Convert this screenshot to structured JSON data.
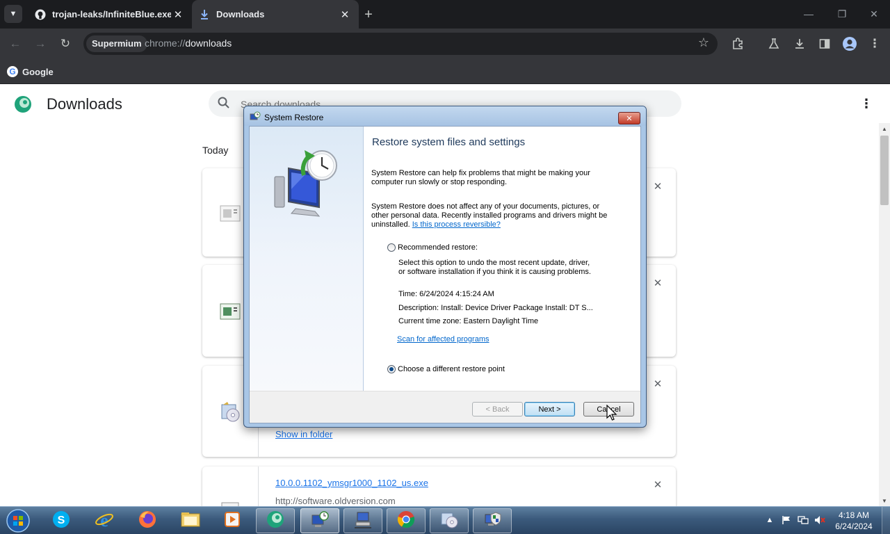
{
  "browser": {
    "tabs": [
      {
        "label": "trojan-leaks/InfiniteBlue.exe at",
        "active": false,
        "icon": "github-icon"
      },
      {
        "label": "Downloads",
        "active": true,
        "icon": "download-icon"
      }
    ],
    "omnibox": {
      "chip_label": "Supermium",
      "url_scheme": "chrome://",
      "url_host": "downloads"
    },
    "bookmarks": [
      {
        "label": "Google",
        "icon": "google-icon"
      }
    ]
  },
  "downloads_page": {
    "title": "Downloads",
    "search_placeholder": "Search downloads",
    "section_label": "Today",
    "items": [
      {
        "icon": "document-icon"
      },
      {
        "icon": "document-icon"
      },
      {
        "icon": "restore-disc-icon",
        "show_in_folder": "Show in folder"
      },
      {
        "name": "10.0.0.1102_ymsgr1000_1102_us.exe",
        "url": "http://software.oldversion.com",
        "icon": "exe-icon"
      }
    ]
  },
  "dialog": {
    "title": "System Restore",
    "heading": "Restore system files and settings",
    "paragraph1": [
      "System Restore can help fix problems that might be making your",
      "computer run slowly or stop responding."
    ],
    "paragraph2": [
      "System Restore does not affect any of your documents, pictures, or",
      "other personal data. Recently installed programs and drivers might be"
    ],
    "paragraph2_last": "uninstalled.",
    "reversible_link": "Is this process reversible?",
    "recommended_label": "Recommended restore:",
    "recommended_desc": [
      "Select this option to undo the most recent update, driver,",
      "or software installation if you think it is causing problems."
    ],
    "time": "Time: 6/24/2024 4:15:24 AM",
    "description": "Description: Install: Device Driver Package Install: DT S...",
    "timezone": "Current time zone: Eastern Daylight Time",
    "scan_link": "Scan for affected programs",
    "choose_label": "Choose a different restore point",
    "selected_option": "choose-different",
    "buttons": {
      "back": "< Back",
      "next": "Next >",
      "cancel": "Cancel"
    }
  },
  "taskbar": {
    "pinned": [
      {
        "icon": "skype-icon"
      },
      {
        "icon": "internet-explorer-icon"
      },
      {
        "icon": "firefox-icon"
      },
      {
        "icon": "file-explorer-icon"
      },
      {
        "icon": "media-player-icon"
      },
      {
        "icon": "supermium-icon"
      },
      {
        "icon": "system-restore-icon"
      },
      {
        "icon": "network-computer-icon"
      },
      {
        "icon": "chrome-icon"
      },
      {
        "icon": "restore-disc-icon"
      },
      {
        "icon": "computer-shield-icon"
      }
    ],
    "clock_time": "4:18 AM",
    "clock_date": "6/24/2024"
  },
  "colors": {
    "chrome_dark": "#35363a",
    "link_blue": "#1a73e8",
    "dialog_frame": "#a9c6e6",
    "taskbar": "#3b5a7c"
  }
}
